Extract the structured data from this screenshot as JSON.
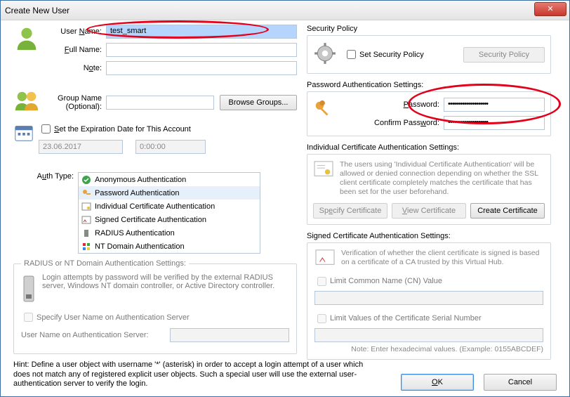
{
  "window": {
    "title": "Create New User"
  },
  "closeGlyph": "✕",
  "user": {
    "userNameLabelPrefix": "User ",
    "userNameLabelU": "N",
    "userNameLabelSuffix": "ame:",
    "userName": "test_smart",
    "fullNameLabelU": "F",
    "fullNameLabelRest": "ull Name:",
    "fullName": "",
    "noteLabelPrefix": "N",
    "noteLabelU": "o",
    "noteLabelSuffix": "te:",
    "note": ""
  },
  "group": {
    "label": "Group Name",
    "optional": "(Optional):",
    "value": "",
    "browse": "Browse Groups..."
  },
  "expiration": {
    "checkboxU": "S",
    "checkboxRest": "et the Expiration Date for This Account",
    "date": "23.06.2017",
    "time": "0:00:00"
  },
  "auth": {
    "labelPrefix": "A",
    "labelU": "u",
    "labelSuffix": "th Type:",
    "items": [
      "Anonymous Authentication",
      "Password Authentication",
      "Individual Certificate Authentication",
      "Signed Certificate Authentication",
      "RADIUS Authentication",
      "NT Domain Authentication"
    ],
    "selectedIndex": 1
  },
  "radius": {
    "legend": "RADIUS or NT Domain Authentication Settings:",
    "desc": "Login attempts by password will be verified by the external RADIUS server, Windows NT domain controller, or Active Directory controller.",
    "specify": "Specify User Name on Authentication Server",
    "userLabel": "User Name on Authentication Server:",
    "userValue": ""
  },
  "security": {
    "heading": "Security Policy",
    "checkbox": "Set Security Policy",
    "button": "Security Policy"
  },
  "pwd": {
    "heading": "Password Authentication Settings:",
    "passwordLabelU": "P",
    "passwordLabelRest": "assword:",
    "password": "••••••••••••••••••••",
    "confirmLabel": "Confirm Pass",
    "confirmU": "w",
    "confirmRest": "ord:",
    "confirm": "••••••••••••••••••••"
  },
  "indcert": {
    "heading": "Individual Certificate Authentication Settings:",
    "desc": "The users using 'Individual Certificate Authentication' will be allowed or denied connection depending on whether the SSL client certificate completely matches the certificate that has been set for the user beforehand.",
    "b1p": "Sp",
    "b1u": "e",
    "b1s": "cify Certificate",
    "b2u": "V",
    "b2s": "iew Certificate",
    "b3": "Create Certificate"
  },
  "signedcert": {
    "heading": "Signed Certificate Authentication Settings:",
    "desc": "Verification of whether the client certificate is signed is based on a certificate of a CA trusted by this Virtual Hub.",
    "cn": "Limit Common Name (CN) Value",
    "serial": "Limit Values of the Certificate Serial Number",
    "note": "Note: Enter hexadecimal values. (Example: 0155ABCDEF)"
  },
  "hint": "Hint: Define a user object with username '*' (asterisk) in order to accept a login attempt of a user which does not match any of registered explicit user objects. Such a special user will use the external user-authentication server to verify the login.",
  "footer": {
    "okU": "O",
    "okRest": "K",
    "cancel": "Cancel"
  }
}
